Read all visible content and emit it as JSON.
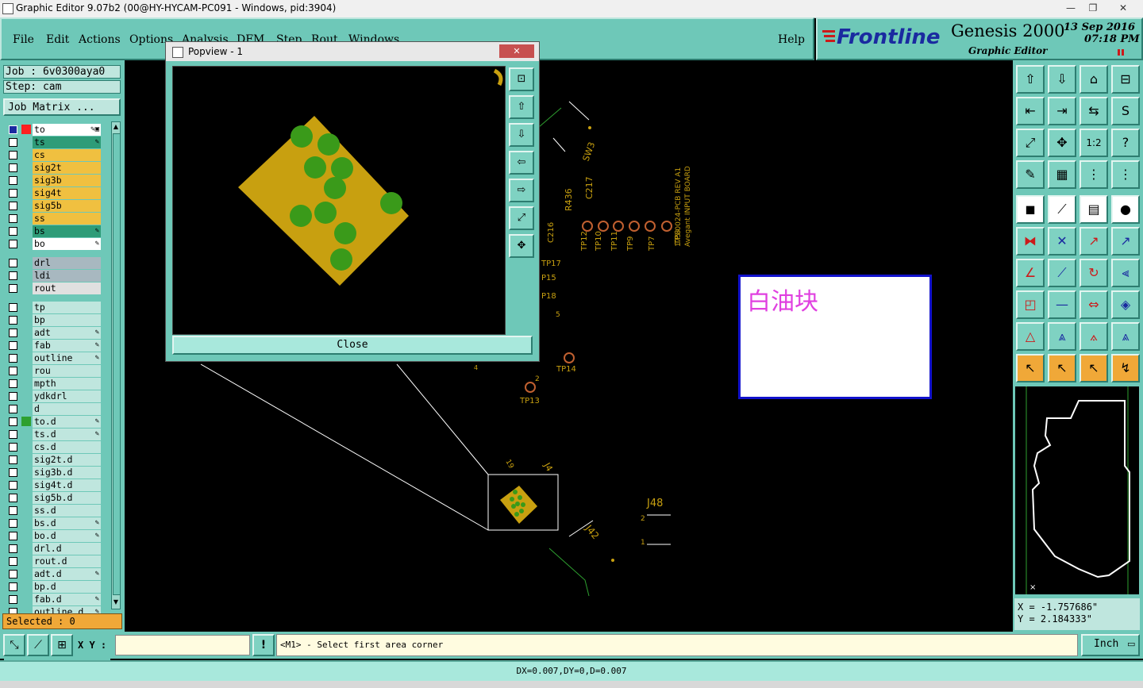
{
  "window": {
    "title": "Graphic Editor 9.07b2 (00@HY-HYCAM-PC091 - Windows, pid:3904)",
    "buttons": [
      "—",
      "❐",
      "✕"
    ]
  },
  "menu": {
    "items": [
      "File",
      "Edit",
      "Actions",
      "Options",
      "Analysis",
      "DFM",
      "Step",
      "Rout",
      "Windows"
    ],
    "help": "Help"
  },
  "brand": {
    "logo": "Frontline",
    "product": "Genesis 2000",
    "subtitle": "Graphic Editor",
    "date": "13 Sep 2016",
    "time": "07:18 PM"
  },
  "job": {
    "job_line": "Job : 6v0300aya0",
    "step_line": "Step: cam",
    "matrix_button": "Job Matrix ..."
  },
  "layers": [
    {
      "name": "to",
      "color": "#ffffff",
      "mark": "✎▣",
      "swatch": "#ff2020",
      "first": true
    },
    {
      "name": "ts",
      "color": "#2e9c78",
      "mark": "✎"
    },
    {
      "name": "cs",
      "color": "#f0c040",
      "mark": ""
    },
    {
      "name": "sig2t",
      "color": "#f0c040",
      "mark": ""
    },
    {
      "name": "sig3b",
      "color": "#f0c040",
      "mark": ""
    },
    {
      "name": "sig4t",
      "color": "#f0c040",
      "mark": ""
    },
    {
      "name": "sig5b",
      "color": "#f0c040",
      "mark": ""
    },
    {
      "name": "ss",
      "color": "#f0c040",
      "mark": ""
    },
    {
      "name": "bs",
      "color": "#2e9c78",
      "mark": "✎"
    },
    {
      "name": "bo",
      "color": "#ffffff",
      "mark": "✎"
    },
    {
      "name": "drl",
      "color": "#a8b8c0",
      "mark": ""
    },
    {
      "name": "ldi",
      "color": "#a8b8c0",
      "mark": ""
    },
    {
      "name": "rout",
      "color": "#e0e0e0",
      "mark": ""
    },
    {
      "name": "tp",
      "color": "#bfe6de",
      "mark": ""
    },
    {
      "name": "bp",
      "color": "#bfe6de",
      "mark": ""
    },
    {
      "name": "adt",
      "color": "#bfe6de",
      "mark": "✎"
    },
    {
      "name": "fab",
      "color": "#bfe6de",
      "mark": "✎"
    },
    {
      "name": "outline",
      "color": "#bfe6de",
      "mark": "✎"
    },
    {
      "name": "rou",
      "color": "#bfe6de",
      "mark": ""
    },
    {
      "name": "mpth",
      "color": "#bfe6de",
      "mark": ""
    },
    {
      "name": "ydkdrl",
      "color": "#bfe6de",
      "mark": ""
    },
    {
      "name": "d",
      "color": "#bfe6de",
      "mark": ""
    },
    {
      "name": "to.d",
      "color": "#bfe6de",
      "mark": "✎",
      "swatch": "#2ea030"
    },
    {
      "name": "ts.d",
      "color": "#bfe6de",
      "mark": "✎"
    },
    {
      "name": "cs.d",
      "color": "#bfe6de",
      "mark": ""
    },
    {
      "name": "sig2t.d",
      "color": "#bfe6de",
      "mark": ""
    },
    {
      "name": "sig3b.d",
      "color": "#bfe6de",
      "mark": ""
    },
    {
      "name": "sig4t.d",
      "color": "#bfe6de",
      "mark": ""
    },
    {
      "name": "sig5b.d",
      "color": "#bfe6de",
      "mark": ""
    },
    {
      "name": "ss.d",
      "color": "#bfe6de",
      "mark": ""
    },
    {
      "name": "bs.d",
      "color": "#bfe6de",
      "mark": "✎"
    },
    {
      "name": "bo.d",
      "color": "#bfe6de",
      "mark": "✎"
    },
    {
      "name": "drl.d",
      "color": "#bfe6de",
      "mark": ""
    },
    {
      "name": "rout.d",
      "color": "#bfe6de",
      "mark": ""
    },
    {
      "name": "adt.d",
      "color": "#bfe6de",
      "mark": "✎"
    },
    {
      "name": "bp.d",
      "color": "#bfe6de",
      "mark": ""
    },
    {
      "name": "fab.d",
      "color": "#bfe6de",
      "mark": "✎"
    },
    {
      "name": "outline.d",
      "color": "#bfe6de",
      "mark": "✎"
    }
  ],
  "selected": "Selected : 0",
  "popview": {
    "title": "Popview - 1",
    "close": "Close",
    "close_x": "✕"
  },
  "canvas": {
    "labels": [
      "SW3",
      "R436",
      "C217",
      "C216",
      "TP12",
      "TP10",
      "TP11",
      "TP9",
      "TP7",
      "TP8",
      "TP17",
      "P15",
      "P18",
      "5",
      "TP14",
      "TP13",
      "2",
      "4",
      "J48",
      "J42",
      "J4",
      "19",
      "2",
      "1"
    ],
    "board_text": [
      "175-0024-PCB REV A1",
      "Avegant INPUT BOARD"
    ],
    "note": "白油块"
  },
  "coords": {
    "x": "X = -1.757686\"",
    "y": "Y = 2.184333\""
  },
  "command": {
    "xy_label": "X Y :",
    "xy_value": "",
    "prompt": "<M1> - Select first area corner",
    "units": "Inch"
  },
  "status": "DX=0.007,DY=0,D=0.007",
  "colors": {
    "panel": "#6ec8b8",
    "pad_copper": "#c8a010",
    "pad_green": "#3a9a1a",
    "trace": "#c8a010",
    "note_border": "#1212cc",
    "note_text": "#e040e0"
  }
}
